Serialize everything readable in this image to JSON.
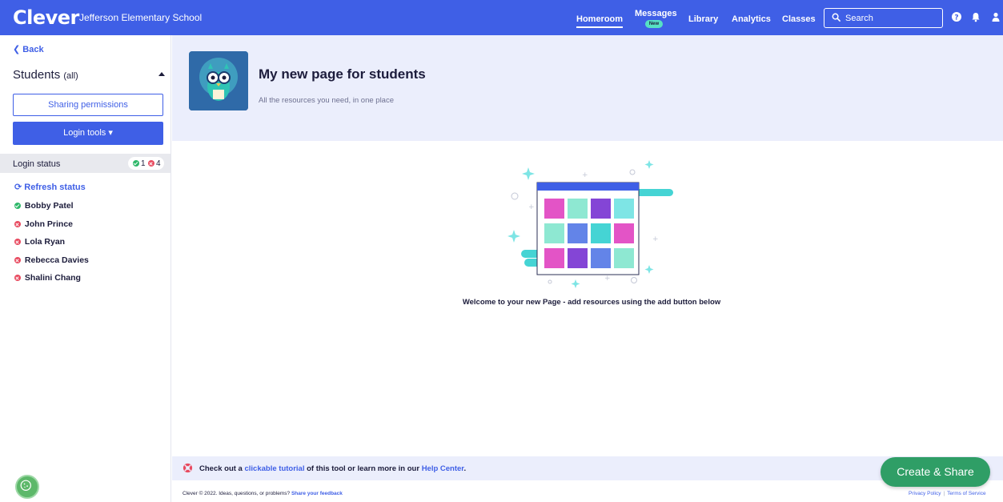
{
  "topbar": {
    "logo": "Clever",
    "school_name": "Jefferson Elementary School",
    "nav": {
      "homeroom": "Homeroom",
      "messages": "Messages",
      "messages_badge": "New",
      "library": "Library",
      "analytics": "Analytics",
      "classes": "Classes"
    },
    "search_placeholder": "Search",
    "colors": {
      "background": "#3f5fe6",
      "badge": "#56e1c4"
    }
  },
  "sidebar": {
    "back": "Back",
    "students_title": "Students",
    "students_filter": "(all)",
    "sharing_permissions": "Sharing permissions",
    "login_tools": "Login tools ▾",
    "login_status_label": "Login status",
    "logged_in_count": "1",
    "logged_out_count": "4",
    "refresh_status": "Refresh status",
    "students": [
      {
        "name": "Bobby Patel",
        "status": "logged-in"
      },
      {
        "name": "John Prince",
        "status": "logged-out"
      },
      {
        "name": "Lola Ryan",
        "status": "logged-out"
      },
      {
        "name": "Rebecca Davies",
        "status": "logged-out"
      },
      {
        "name": "Shalini Chang",
        "status": "logged-out"
      }
    ],
    "colors": {
      "green": "#2fb86a",
      "red": "#e84a5f"
    }
  },
  "main": {
    "page_title": "My new page for students",
    "page_subtitle": "All the resources you need, in one place",
    "welcome": "Welcome to your new Page - add resources using the add button below",
    "help": {
      "prefix": "Check out a ",
      "link1": "clickable tutorial",
      "middle": " of this tool or learn more in our ",
      "link2": "Help Center",
      "suffix": "."
    },
    "create_share": "Create & Share",
    "footer": {
      "copyright": "Clever © 2022. Ideas, questions, or problems? ",
      "feedback_link": "Share your feedback",
      "privacy": "Privacy Policy",
      "terms": "Terms of Service"
    }
  }
}
